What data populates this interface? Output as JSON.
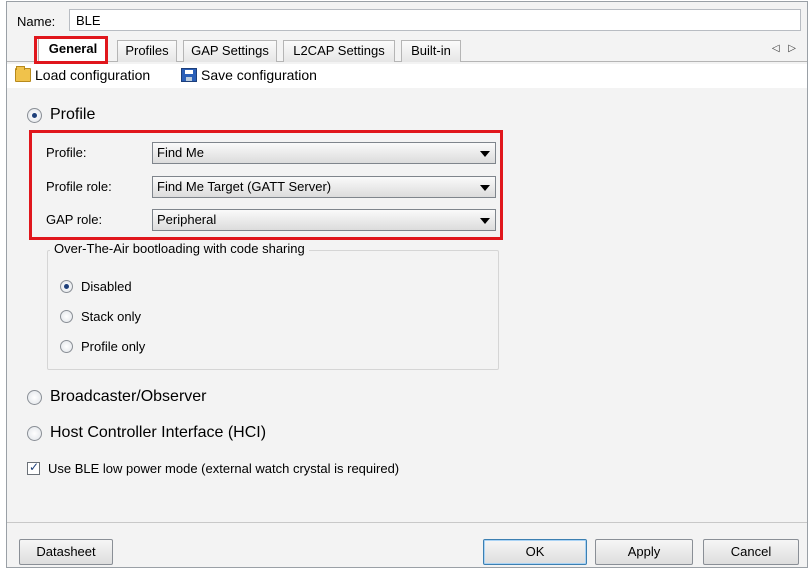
{
  "name_row": {
    "label": "Name:",
    "value": "BLE"
  },
  "tabs": [
    {
      "label": "General",
      "active": true
    },
    {
      "label": "Profiles",
      "active": false
    },
    {
      "label": "GAP Settings",
      "active": false
    },
    {
      "label": "L2CAP Settings",
      "active": false
    },
    {
      "label": "Built-in",
      "active": false
    }
  ],
  "tab_scroll": "◁ ▷",
  "toolbar": {
    "load_label": "Load configuration",
    "save_label": "Save configuration"
  },
  "mode_profile": {
    "label": "Profile",
    "selected": true
  },
  "profile_fields": {
    "profile": {
      "label": "Profile:",
      "value": "Find Me"
    },
    "role": {
      "label": "Profile role:",
      "value": "Find Me Target (GATT Server)"
    },
    "gap": {
      "label": "GAP role:",
      "value": "Peripheral"
    }
  },
  "ota": {
    "title": "Over-The-Air bootloading with code sharing",
    "options": [
      {
        "label": "Disabled",
        "selected": true
      },
      {
        "label": "Stack only",
        "selected": false
      },
      {
        "label": "Profile only",
        "selected": false
      }
    ]
  },
  "mode_broadcaster": {
    "label": "Broadcaster/Observer",
    "selected": false
  },
  "mode_hci": {
    "label": "Host Controller Interface (HCI)",
    "selected": false
  },
  "low_power": {
    "label": "Use BLE low power mode (external watch crystal is required)",
    "checked": true
  },
  "buttons": {
    "datasheet": "Datasheet",
    "ok": "OK",
    "apply": "Apply",
    "cancel": "Cancel"
  },
  "colors": {
    "highlight": "#e0161c",
    "radio_dot": "#1d3f7a"
  }
}
